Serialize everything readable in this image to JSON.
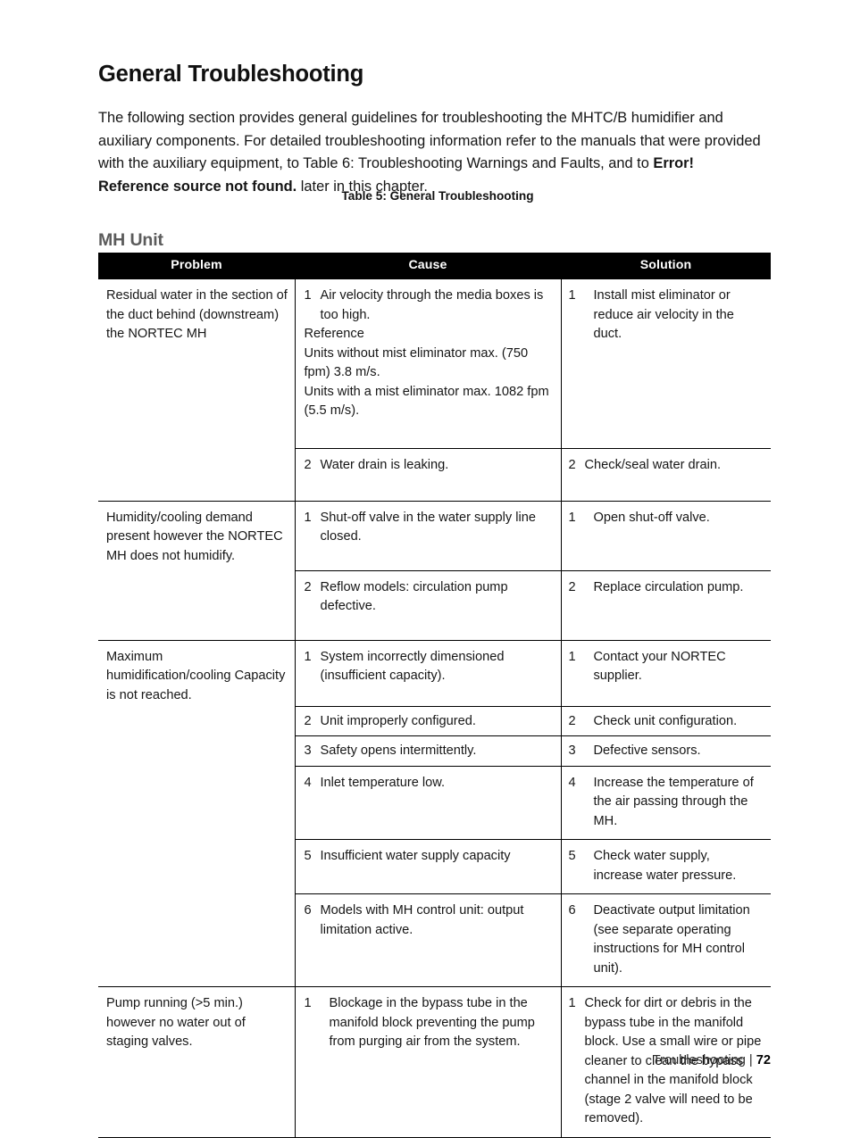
{
  "document": {
    "title": "General Troubleshooting",
    "intro": {
      "part1": "The following section provides general guidelines for troubleshooting the MHTC/B humidifier and auxiliary components.  For detailed troubleshooting information refer to the manuals that were provided with the auxiliary equipment, to Table 6: Troubleshooting Warnings and Faults, and to ",
      "bold": "Error! Reference source not found.",
      "part2": " later in this chapter."
    },
    "table_caption": "Table 5: General Troubleshooting",
    "sub_heading": "MH Unit"
  },
  "table": {
    "headers": {
      "problem": "Problem",
      "cause": "Cause",
      "solution": "Solution"
    },
    "rows": [
      {
        "problem": "Residual water in the section of the duct behind (downstream) the NORTEC MH",
        "cause_num": "1",
        "cause": "Air velocity through the media boxes is too high.",
        "cause_extra1": "Reference",
        "cause_extra2": "Units without mist eliminator max. (750 fpm) 3.8 m/s.",
        "cause_extra3": "Units with a mist eliminator max. 1082 fpm (5.5 m/s).",
        "solution_num": "1",
        "solution": "Install mist eliminator or reduce air velocity in the duct."
      },
      {
        "cause_num": "2",
        "cause": "Water drain is leaking.",
        "solution_num": "2",
        "solution": "Check/seal water drain."
      },
      {
        "problem": "Humidity/cooling demand present however the NORTEC MH does not humidify.",
        "cause_num": "1",
        "cause": "Shut-off valve in the water supply line closed.",
        "solution_num": "1",
        "solution": "Open shut-off valve."
      },
      {
        "cause_num": "2",
        "cause": "Reflow models: circulation pump defective.",
        "solution_num": "2",
        "solution": "Replace circulation pump."
      },
      {
        "problem": "Maximum humidification/cooling Capacity is not reached.",
        "cause_num": "1",
        "cause": "System incorrectly dimensioned (insufficient capacity).",
        "solution_num": "1",
        "solution": "Contact your NORTEC supplier."
      },
      {
        "cause_num": "2",
        "cause": "Unit improperly configured.",
        "solution_num": "2",
        "solution": "Check unit configuration."
      },
      {
        "cause_num": "3",
        "cause": "Safety opens intermittently.",
        "solution_num": "3",
        "solution": "Defective sensors."
      },
      {
        "cause_num": "4",
        "cause": "Inlet temperature low.",
        "solution_num": "4",
        "solution": "Increase the temperature of the air passing through the MH."
      },
      {
        "cause_num": "5",
        "cause": "Insufficient water supply capacity",
        "solution_num": "5",
        "solution": "Check water supply, increase water pressure."
      },
      {
        "cause_num": "6",
        "cause": "Models with MH control unit: output limitation active.",
        "solution_num": "6",
        "solution": "Deactivate output limitation (see separate operating instructions for MH control unit)."
      },
      {
        "problem": "Pump running (>5 min.) however no water out of staging valves.",
        "cause_num": "1",
        "cause": "Blockage in the bypass tube in the manifold block preventing the pump from purging air from the system.",
        "solution_num": "1",
        "solution": "Check for dirt or debris in the bypass tube in the manifold block. Use a small wire or pipe cleaner to clean the bypass channel in the manifold block (stage 2 valve will need to be removed)."
      }
    ]
  },
  "footer": {
    "chapter": "Troubleshooting",
    "separator": "|",
    "page_number": "72"
  }
}
